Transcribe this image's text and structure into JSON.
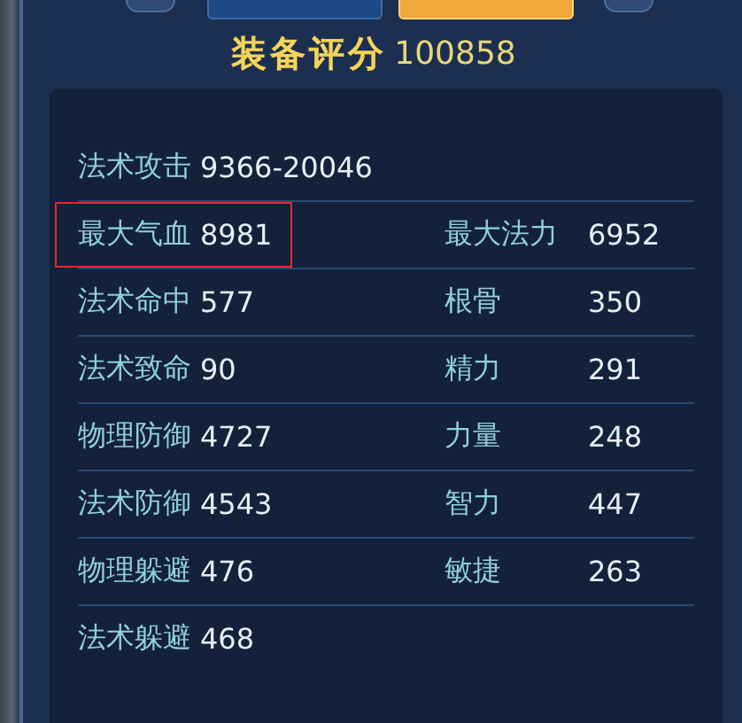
{
  "tabs": [
    {
      "selected": false
    },
    {
      "selected": true
    }
  ],
  "score": {
    "label": "装备评分",
    "value": "100858"
  },
  "rows": [
    {
      "cells": [
        {
          "label": "法术攻击",
          "value": "9366-20046",
          "highlighted": false
        }
      ]
    },
    {
      "cells": [
        {
          "label": "最大气血",
          "value": "8981",
          "highlighted": true
        },
        {
          "label": "最大法力",
          "value": "6952",
          "highlighted": false
        }
      ]
    },
    {
      "cells": [
        {
          "label": "法术命中",
          "value": "577",
          "highlighted": false
        },
        {
          "label": "根骨",
          "value": "350",
          "highlighted": false
        }
      ]
    },
    {
      "cells": [
        {
          "label": "法术致命",
          "value": "90",
          "highlighted": false
        },
        {
          "label": "精力",
          "value": "291",
          "highlighted": false
        }
      ]
    },
    {
      "cells": [
        {
          "label": "物理防御",
          "value": "4727",
          "highlighted": false
        },
        {
          "label": "力量",
          "value": "248",
          "highlighted": false
        }
      ]
    },
    {
      "cells": [
        {
          "label": "法术防御",
          "value": "4543",
          "highlighted": false
        },
        {
          "label": "智力",
          "value": "447",
          "highlighted": false
        }
      ]
    },
    {
      "cells": [
        {
          "label": "物理躲避",
          "value": "476",
          "highlighted": false
        },
        {
          "label": "敏捷",
          "value": "263",
          "highlighted": false
        }
      ]
    },
    {
      "cells": [
        {
          "label": "法术躲避",
          "value": "468",
          "highlighted": false
        }
      ]
    }
  ]
}
